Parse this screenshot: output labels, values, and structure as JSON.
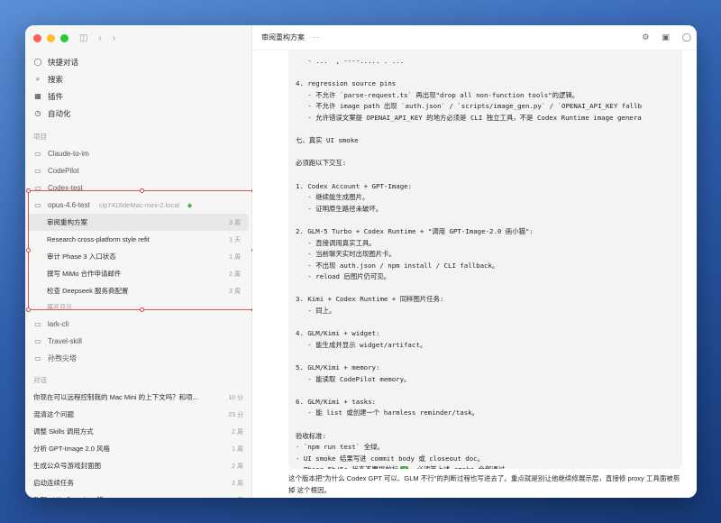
{
  "window": {
    "traffic_lights": [
      "#ff5f57",
      "#febc2e",
      "#28c840"
    ]
  },
  "sidebar": {
    "nav": [
      {
        "icon": "chat-bubble-icon",
        "glyph": "◯",
        "label": "快捷对话"
      },
      {
        "icon": "search-icon",
        "glyph": "⌕",
        "label": "搜索"
      },
      {
        "icon": "plugin-icon",
        "glyph": "▦",
        "label": "插件"
      },
      {
        "icon": "clock-icon",
        "glyph": "◷",
        "label": "自动化"
      }
    ],
    "projects_label": "项目",
    "projects": [
      {
        "label": "Claude-to-im"
      },
      {
        "label": "CodePilot"
      },
      {
        "label": "Codex-test"
      }
    ],
    "active_project": {
      "label": "opus-4.6-test",
      "meta": "cip7418deMac-mini-2.local",
      "status_color": "#33b34a",
      "threads": [
        {
          "label": "审阅重构方案",
          "age": "3 周"
        },
        {
          "label": "Research cross-platform style refit",
          "age": "1 天"
        },
        {
          "label": "审计 Phase 3 入口状态",
          "age": "1 周"
        },
        {
          "label": "撰写 MiMo 合作申请邮件",
          "age": "2 周"
        },
        {
          "label": "检查 Deepseek 服务商配置",
          "age": "3 周"
        }
      ],
      "show_more": "展开显示"
    },
    "projects_after": [
      {
        "label": "lark-cli"
      },
      {
        "label": "Travel-skill"
      },
      {
        "label": "孙煦尖塔"
      }
    ],
    "conversations_label": "对话",
    "conversations": [
      {
        "label": "你现在可以远程控制我的 Mac Mini 的上下文吗？和项...",
        "age": "10 分"
      },
      {
        "label": "混清这个问题",
        "age": "23 分"
      },
      {
        "label": "调整 Skills 调用方式",
        "age": "2 周"
      },
      {
        "label": "分析 GPT-Image 2.0 风格",
        "age": "1 周"
      },
      {
        "label": "生成公众号游戏封面图",
        "age": "2 周"
      },
      {
        "label": "启动连续任务",
        "age": "2 周"
      },
      {
        "label": "改写 Skills 为 Twitter 版",
        "age": "2 周"
      }
    ]
  },
  "main": {
    "title": "审阅重构方案",
    "more": "···",
    "header_icons": [
      "settings-icon",
      "terminal-icon",
      "circle-icon"
    ],
    "code_lines": [
      "   - ...  , ----..... . ...",
      "",
      "4. regression source pins",
      "   - 不允许 `parse-request.ts` 再出现\"drop all non-function tools\"的逻辑。",
      "   - 不允许 image path 出现 `auth.json` / `scripts/image_gen.py` / `OPENAI_API_KEY fallb",
      "   - 允许错误文案提 OPENAI_API_KEY 的地方必须是 CLI 独立工具，不是 Codex Runtime image genera",
      "",
      "七、真实 UI smoke",
      "",
      "必须跑以下交互:",
      "",
      "1. Codex Account + GPT-Image:",
      "   - 继续能生成图片。",
      "   - 证明原生路径未破坏。",
      "",
      "2. GLM-5 Turbo + Codex Runtime + \"调用 GPT-Image-2.0 画小猫\":",
      "   - 直接调用真实工具。",
      "   - 当前聊天实时出现图片卡。",
      "   - 不出现 auth.json / npm install / CLI fallback。",
      "   - reload 后图片仍可见。",
      "",
      "3. Kimi + Codex Runtime + 同样图片任务:",
      "   - 同上。",
      "",
      "4. GLM/Kimi + widget:",
      "   - 能生成并显示 widget/artifact。",
      "",
      "5. GLM/Kimi + memory:",
      "   - 能读取 CodePilot memory。",
      "",
      "6. GLM/Kimi + tasks:",
      "   - 能 list 或创建一个 harmless reminder/task。",
      "",
      "验收标准:",
      "- `npm run test` 全绿。",
      "- UI smoke 结果写进 commit body 或 closeout doc。",
      "- Phase 5b/5c 状态不要提前标"
    ],
    "check_tail": "，必须等上述 smoke 全部通过。",
    "paragraph": "这个版本把\"为什么 Codex GPT 可以、GLM 不行\"的判断过程也写进去了。重点就是别让他继续修展示层，直接修 proxy 工具面被剪掉 这个根因。"
  }
}
